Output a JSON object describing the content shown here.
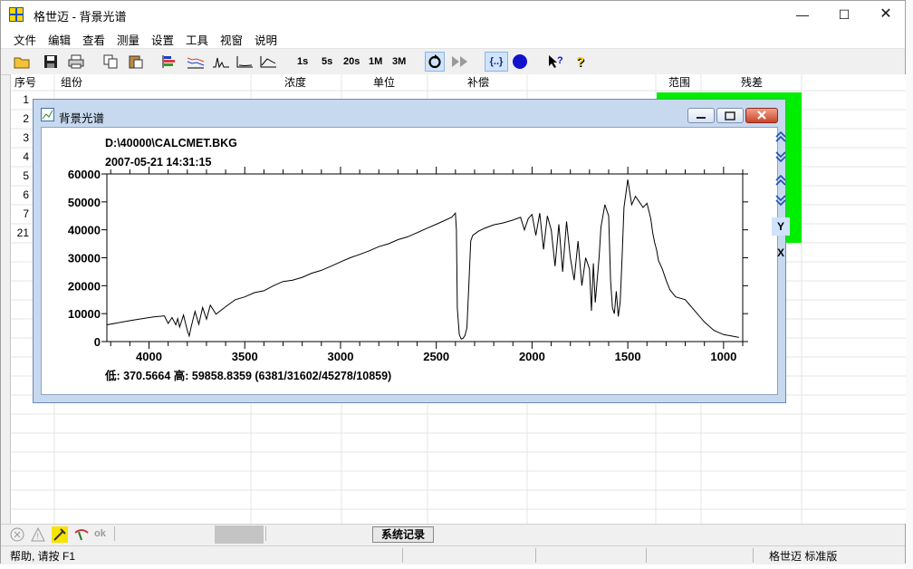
{
  "window": {
    "title": "格世迈 - 背景光谱"
  },
  "menu": [
    "文件",
    "编辑",
    "查看",
    "测量",
    "设置",
    "工具",
    "视窗",
    "说明"
  ],
  "toolbar": {
    "time_labels": [
      "1s",
      "5s",
      "20s",
      "1M",
      "3M"
    ],
    "bracket_label": "{..}"
  },
  "table": {
    "headers": {
      "index": "序号",
      "component": "组份",
      "concentration": "浓度",
      "unit": "单位",
      "compensation": "补偿",
      "range": "范围",
      "residual": "残差"
    },
    "row_numbers": [
      "1",
      "2",
      "3",
      "4",
      "5",
      "6",
      "7",
      "21"
    ],
    "accent_color": "#00ee00"
  },
  "bottom_tab": {
    "label": "系统记录",
    "ok_label": "ok"
  },
  "status": {
    "help": "帮助, 请按 F1",
    "edition": "格世迈 标准版"
  },
  "child_window": {
    "title": "背景光谱",
    "file_path": "D:\\40000\\CALCMET.BKG",
    "timestamp": "2007-05-21 14:31:15",
    "stats": "低: 370.5664  高: 59858.8359   (6381/31602/45278/10859)",
    "side_buttons": [
      "Y",
      "X"
    ]
  },
  "chart_data": {
    "type": "line",
    "title": "",
    "xlabel": "",
    "ylabel": "",
    "x_reversed": true,
    "xlim": [
      4220,
      900
    ],
    "ylim": [
      0,
      60000
    ],
    "x_ticks": [
      4000,
      3500,
      3000,
      2500,
      2000,
      1500,
      1000
    ],
    "y_ticks": [
      0,
      10000,
      20000,
      30000,
      40000,
      50000,
      60000
    ],
    "color": "#000000",
    "series": [
      {
        "x": [
          4220,
          4100,
          3980,
          3920,
          3900,
          3880,
          3860,
          3850,
          3840,
          3820,
          3800,
          3790,
          3780,
          3760,
          3740,
          3720,
          3700,
          3680,
          3650,
          3600,
          3550,
          3500,
          3450,
          3400,
          3350,
          3300,
          3250,
          3200,
          3150,
          3100,
          3050,
          3000,
          2950,
          2900,
          2850,
          2800,
          2750,
          2700,
          2650,
          2600,
          2550,
          2500,
          2420,
          2400,
          2395,
          2390,
          2380,
          2370,
          2360,
          2350,
          2340,
          2330,
          2320,
          2310,
          2300,
          2280,
          2250,
          2200,
          2150,
          2100,
          2060,
          2040,
          2020,
          2000,
          1980,
          1960,
          1940,
          1920,
          1900,
          1880,
          1860,
          1840,
          1820,
          1800,
          1780,
          1760,
          1740,
          1720,
          1700,
          1690,
          1680,
          1670,
          1660,
          1650,
          1640,
          1620,
          1600,
          1590,
          1580,
          1570,
          1560,
          1550,
          1540,
          1530,
          1520,
          1500,
          1480,
          1460,
          1440,
          1420,
          1400,
          1380,
          1370,
          1360,
          1350,
          1340,
          1320,
          1300,
          1280,
          1250,
          1200,
          1150,
          1100,
          1050,
          1000,
          960,
          920
        ],
        "y": [
          6000,
          7500,
          8800,
          9200,
          6500,
          8600,
          6000,
          8200,
          5200,
          9500,
          4000,
          2000,
          5200,
          10800,
          6200,
          12200,
          8000,
          13000,
          9800,
          12500,
          15000,
          16000,
          17500,
          18200,
          20000,
          21500,
          22000,
          23000,
          24500,
          25500,
          27000,
          28500,
          30000,
          31200,
          32500,
          34000,
          35000,
          36500,
          37500,
          39000,
          40500,
          42000,
          44500,
          46000,
          40000,
          12000,
          2500,
          900,
          1200,
          2200,
          5000,
          20000,
          36000,
          38000,
          38500,
          39500,
          40500,
          41800,
          42500,
          43500,
          44500,
          40000,
          44000,
          45500,
          38000,
          46000,
          33000,
          45000,
          40000,
          27000,
          42000,
          25000,
          43000,
          30000,
          22000,
          36000,
          20000,
          30000,
          26000,
          11000,
          28000,
          14000,
          22000,
          30000,
          41000,
          49000,
          45000,
          22000,
          12000,
          10000,
          18000,
          9000,
          14000,
          30000,
          48000,
          58000,
          49000,
          52000,
          50000,
          48000,
          49500,
          44000,
          39000,
          35500,
          33000,
          29000,
          26000,
          22000,
          18500,
          16000,
          15000,
          11000,
          7000,
          4000,
          2500,
          2000,
          1500
        ],
        "_note": ""
      }
    ]
  }
}
